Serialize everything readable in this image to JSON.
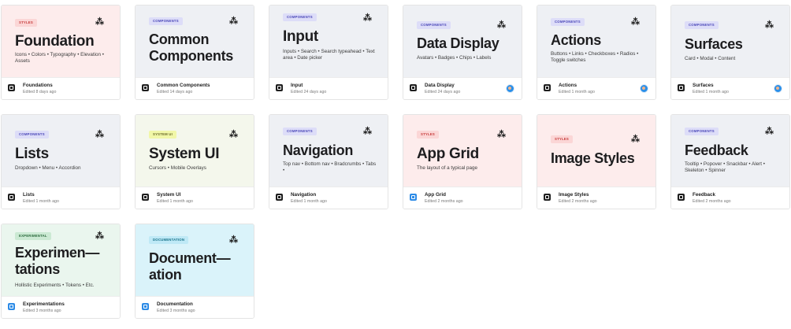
{
  "cards": [
    {
      "badge": "STYLES",
      "badge_type": "styles",
      "title": "Foundation",
      "desc": "Icons • Colors • Typography • Elevation • Assets",
      "name": "Foundations",
      "edited": "Edited 8 days ago",
      "thumb": "pink",
      "footer_icon": "dark",
      "avatar": false
    },
    {
      "badge": "COMPONENTS",
      "badge_type": "comp",
      "title": "Common Components",
      "desc": "",
      "name": "Common Components",
      "edited": "Edited 14 days ago",
      "thumb": "grey",
      "footer_icon": "dark",
      "avatar": false
    },
    {
      "badge": "COMPONENTS",
      "badge_type": "comp",
      "title": "Input",
      "desc": "Inputs • Search • Search typeahead • Text area • Date picker",
      "name": "Input",
      "edited": "Edited 24 days ago",
      "thumb": "grey",
      "footer_icon": "dark",
      "avatar": false
    },
    {
      "badge": "COMPONENTS",
      "badge_type": "comp",
      "title": "Data Display",
      "desc": "Avatars • Badges • Chips • Labels",
      "name": "Data Display",
      "edited": "Edited 24 days ago",
      "thumb": "grey",
      "footer_icon": "dark",
      "avatar": true
    },
    {
      "badge": "COMPONENTS",
      "badge_type": "comp",
      "title": "Actions",
      "desc": "Buttons • Links • Checkboxes • Radios • Toggle switches",
      "name": "Actions",
      "edited": "Edited 1 month ago",
      "thumb": "grey",
      "footer_icon": "dark",
      "avatar": true
    },
    {
      "badge": "COMPONENTS",
      "badge_type": "comp",
      "title": "Surfaces",
      "desc": "Card • Modal • Content",
      "name": "Surfaces",
      "edited": "Edited 1 month ago",
      "thumb": "grey",
      "footer_icon": "dark",
      "avatar": true
    },
    {
      "badge": "COMPONENTS",
      "badge_type": "comp",
      "title": "Lists",
      "desc": "Dropdown • Menu • Accordion",
      "name": "Lists",
      "edited": "Edited 1 month ago",
      "thumb": "grey",
      "footer_icon": "dark",
      "avatar": false
    },
    {
      "badge": "SYSTEM UI",
      "badge_type": "sys",
      "title": "System UI",
      "desc": "Cursors • Mobile Overlays",
      "name": "System UI",
      "edited": "Edited 1 month ago",
      "thumb": "yellow",
      "footer_icon": "dark",
      "avatar": false
    },
    {
      "badge": "COMPONENTS",
      "badge_type": "comp",
      "title": "Navigation",
      "desc": "Top nav • Bottom nav • Bradcrumbs • Tabs •",
      "name": "Navigation",
      "edited": "Edited 1 month ago",
      "thumb": "grey",
      "footer_icon": "dark",
      "avatar": false
    },
    {
      "badge": "STYLES",
      "badge_type": "styles",
      "title": "App Grid",
      "desc": "The layout of a typical page",
      "name": "App Grid",
      "edited": "Edited 2 months ago",
      "thumb": "pink",
      "footer_icon": "blue",
      "avatar": false
    },
    {
      "badge": "STYLES",
      "badge_type": "styles",
      "title": "Image Styles",
      "desc": "",
      "name": "Image Styles",
      "edited": "Edited 2 months ago",
      "thumb": "pink",
      "footer_icon": "dark",
      "avatar": false
    },
    {
      "badge": "COMPONENTS",
      "badge_type": "comp",
      "title": "Feedback",
      "desc": "Tooltip • Popover • Snackbar • Alert • Skeleton • Spinner",
      "name": "Feedback",
      "edited": "Edited 2 months ago",
      "thumb": "grey",
      "footer_icon": "dark",
      "avatar": false
    },
    {
      "badge": "EXPERIMENTAL",
      "badge_type": "exp",
      "title": "Experimen— tations",
      "desc": "Hollistic Experiments • Tokens • Etc.",
      "name": "Experimentations",
      "edited": "Edited 3 months ago",
      "thumb": "green",
      "footer_icon": "blue",
      "avatar": false
    },
    {
      "badge": "DOCUMENTATION",
      "badge_type": "doc",
      "title": "Document— ation",
      "desc": "",
      "name": "Documentation",
      "edited": "Edited 3 months ago",
      "thumb": "cyan",
      "footer_icon": "blue",
      "avatar": false
    }
  ]
}
